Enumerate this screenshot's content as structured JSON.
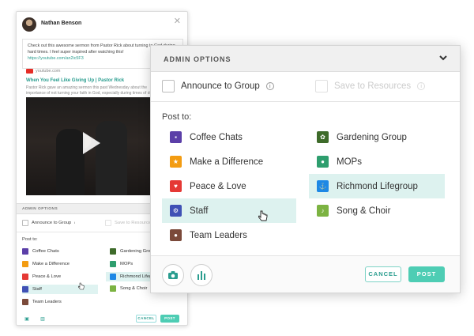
{
  "composer": {
    "author": "Nathan Benson",
    "message_line1": "Check out this awesome sermon from Pastor Rick about turning to God",
    "message_line2": "during hard times. I feel super inspired after watching this!",
    "message_link": "https://youtube.com/an2ic5F3",
    "preview_source": "youtube.com",
    "preview_title": "When You Feel Like Giving Up | Pastor Rick",
    "preview_desc": "Pastor Rick gave an amazing sermon this past Wednesday about the importance of not turning your faith in God, especially during times of doubt. Check it out!"
  },
  "admin": {
    "title": "ADMIN OPTIONS",
    "small_title": "ADMIN OPTIONS",
    "announce_label": "Announce to Group",
    "save_label": "Save to Resources",
    "post_to_label": "Post to:",
    "groups_left": [
      {
        "label": "Coffee Chats",
        "color": "#5b3fa8",
        "icon": "chat-icon"
      },
      {
        "label": "Make a Difference",
        "color": "#f39c12",
        "icon": "star-icon"
      },
      {
        "label": "Peace & Love",
        "color": "#e53935",
        "icon": "heart-icon"
      },
      {
        "label": "Staff",
        "color": "#3f51b5",
        "icon": "gear-icon",
        "selected": true
      },
      {
        "label": "Team Leaders",
        "color": "#7b4a3a",
        "icon": "person-icon"
      }
    ],
    "groups_right": [
      {
        "label": "Gardening Group",
        "color": "#3e6b2a",
        "icon": "plant-icon"
      },
      {
        "label": "MOPs",
        "color": "#2e9e6e",
        "icon": "group-icon"
      },
      {
        "label": "Richmond Lifegroup",
        "color": "#1e88e5",
        "icon": "anchor-icon",
        "selected": true
      },
      {
        "label": "Song & Choir",
        "color": "#7cb342",
        "icon": "music-icon"
      }
    ],
    "small_groups_right": [
      "Gardening Group",
      "MOPs",
      "Richmond Lifegr",
      "Song & Choir"
    ]
  },
  "footer": {
    "cancel_label": "CANCEL",
    "post_label": "POST"
  }
}
